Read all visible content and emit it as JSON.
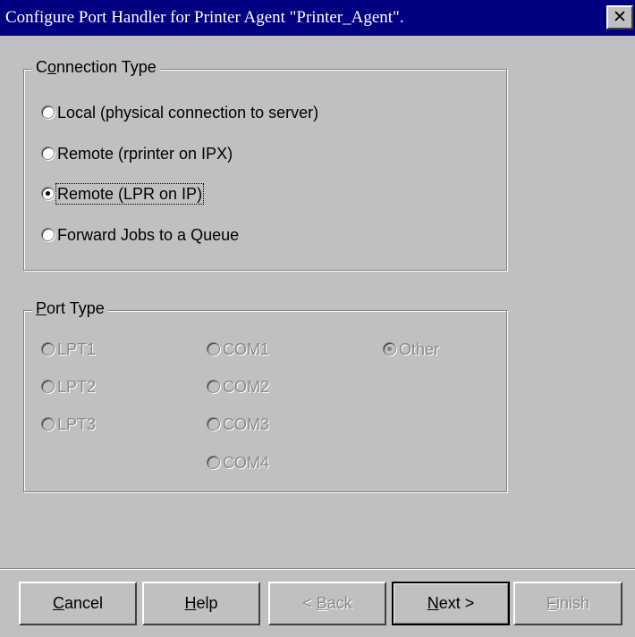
{
  "window": {
    "title": "Configure Port Handler for Printer Agent \"Printer_Agent\".",
    "close_icon": "close-x-icon"
  },
  "connection_type": {
    "label_pre": "C",
    "label_accel": "o",
    "label_post": "nnection Type",
    "options": [
      {
        "label": "Local (physical connection to server)",
        "selected": false
      },
      {
        "label": "Remote (rprinter on IPX)",
        "selected": false
      },
      {
        "label": "Remote (LPR on IP)",
        "selected": true
      },
      {
        "label": "Forward Jobs to a Queue",
        "selected": false
      }
    ]
  },
  "port_type": {
    "label_accel": "P",
    "label_post": "ort Type",
    "enabled": false,
    "options": [
      {
        "label": "LPT1",
        "selected": false
      },
      {
        "label": "LPT2",
        "selected": false
      },
      {
        "label": "LPT3",
        "selected": false
      },
      {
        "label": "COM1",
        "selected": false
      },
      {
        "label": "COM2",
        "selected": false
      },
      {
        "label": "COM3",
        "selected": false
      },
      {
        "label": "COM4",
        "selected": false
      },
      {
        "label": "Other",
        "selected": true
      }
    ]
  },
  "buttons": {
    "cancel": {
      "accel": "C",
      "rest": "ancel"
    },
    "help": {
      "accel": "H",
      "rest": "elp"
    },
    "back": {
      "prefix": "< ",
      "accel": "B",
      "rest": "ack",
      "enabled": false
    },
    "next": {
      "accel": "N",
      "rest": "ext",
      "suffix": " >",
      "default": true
    },
    "finish": {
      "accel": "F",
      "rest": "inish",
      "enabled": false
    }
  }
}
